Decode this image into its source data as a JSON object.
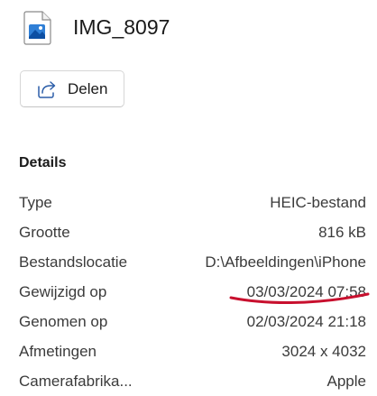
{
  "file": {
    "name": "IMG_8097",
    "icon": "image-file-icon"
  },
  "toolbar": {
    "share_label": "Delen",
    "share_icon": "share-icon"
  },
  "details": {
    "title": "Details",
    "rows": [
      {
        "label": "Type",
        "value": "HEIC-bestand"
      },
      {
        "label": "Grootte",
        "value": "816 kB"
      },
      {
        "label": "Bestandslocatie",
        "value": "D:\\Afbeeldingen\\iPhone"
      },
      {
        "label": "Gewijzigd op",
        "value": "03/03/2024 07:58"
      },
      {
        "label": "Genomen op",
        "value": "02/03/2024 21:18"
      },
      {
        "label": "Afmetingen",
        "value": "3024 x 4032"
      },
      {
        "label": "Camerafabrika...",
        "value": "Apple"
      }
    ]
  },
  "colors": {
    "annotation": "#c8102e",
    "file_icon_blue": "#2f7fd6"
  }
}
